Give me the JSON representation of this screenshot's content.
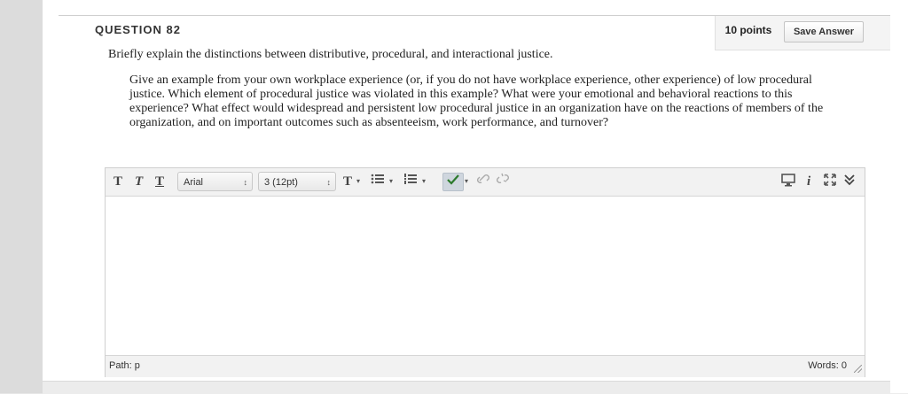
{
  "question": {
    "title": "QUESTION 82",
    "points": "10 points",
    "save_label": "Save Answer",
    "prompt_main": "Briefly explain the distinctions between distributive, procedural, and interactional justice.",
    "prompt_detail": "Give an example from your own workplace experience (or, if you do not have workplace experience, other experience) of low procedural justice.  Which element of procedural justice was violated in this example?  What were your emotional and behavioral reactions to this experience?  What effect would widespread and persistent low procedural justice in an organization have on the reactions of members of the organization, and on important outcomes such as absenteeism, work performance, and turnover?"
  },
  "toolbar": {
    "bold": "T",
    "italic": "T",
    "underline": "T",
    "font_family": "Arial",
    "font_size": "3 (12pt)",
    "text_color": "T",
    "select_arrow": "↕",
    "caret": "▾",
    "info": "i"
  },
  "status": {
    "path": "Path: p",
    "words": "Words: 0"
  },
  "colors": {
    "spellcheck_check": "#2d7a2d"
  }
}
